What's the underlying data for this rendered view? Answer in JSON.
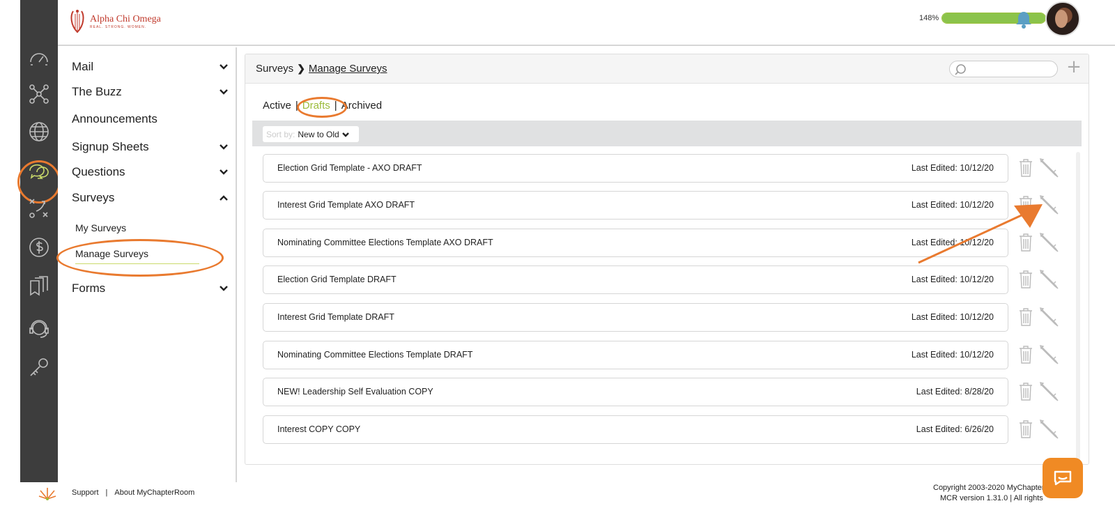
{
  "header": {
    "brand_name": "Alpha Chi Omega",
    "brand_tagline": "REAL. STRONG. WOMEN.",
    "progress_label": "148%",
    "progress_value": 1.48,
    "colors": {
      "accent": "#9cbb3a",
      "brand": "#c0392b",
      "highlight": "#e97a2f",
      "rail": "#3d3d3d"
    }
  },
  "rail": {
    "icons": [
      "dashboard-icon",
      "network-icon",
      "globe-icon",
      "communications-icon",
      "strategy-icon",
      "finance-icon",
      "documents-icon",
      "support-icon",
      "key-icon"
    ],
    "active": "communications-icon"
  },
  "subnav": {
    "items": [
      {
        "label": "Mail",
        "chevron": "down"
      },
      {
        "label": "The Buzz",
        "chevron": "down"
      },
      {
        "label": "Announcements",
        "chevron": ""
      },
      {
        "label": "Signup Sheets",
        "chevron": "down"
      },
      {
        "label": "Questions",
        "chevron": "down"
      },
      {
        "label": "Surveys",
        "chevron": "up"
      },
      {
        "label": "Forms",
        "chevron": "down"
      }
    ],
    "surveys_children": [
      "My Surveys",
      "Manage Surveys"
    ]
  },
  "main": {
    "breadcrumb_root": "Surveys",
    "breadcrumb_current": "Manage Surveys",
    "tabs": [
      "Active",
      "Drafts",
      "Archived"
    ],
    "active_tab": "Drafts",
    "sort_label": "Sort by:",
    "sort_value": "New to Old",
    "edited_prefix": "Last Edited:",
    "rows": [
      {
        "title": "Election Grid Template - AXO DRAFT",
        "date": "Last Edited: 10/12/20"
      },
      {
        "title": "Interest Grid Template AXO DRAFT",
        "date": "Last Edited: 10/12/20"
      },
      {
        "title": "Nominating Committee Elections Template AXO DRAFT",
        "date": "Last Edited: 10/12/20"
      },
      {
        "title": "Election Grid Template DRAFT",
        "date": "Last Edited: 10/12/20"
      },
      {
        "title": "Interest Grid Template DRAFT",
        "date": "Last Edited: 10/12/20"
      },
      {
        "title": "Nominating Committee Elections Template DRAFT",
        "date": "Last Edited: 10/12/20"
      },
      {
        "title": "NEW! Leadership Self Evaluation COPY",
        "date": "Last Edited: 8/28/20"
      },
      {
        "title": "Interest COPY COPY",
        "date": "Last Edited: 6/26/20"
      }
    ]
  },
  "footer": {
    "support": "Support",
    "separator": "|",
    "about": "About MyChapterRoom",
    "copyright": "Copyright 2003-2020 MyChapter",
    "version": "MCR version 1.31.0 | All rights"
  }
}
